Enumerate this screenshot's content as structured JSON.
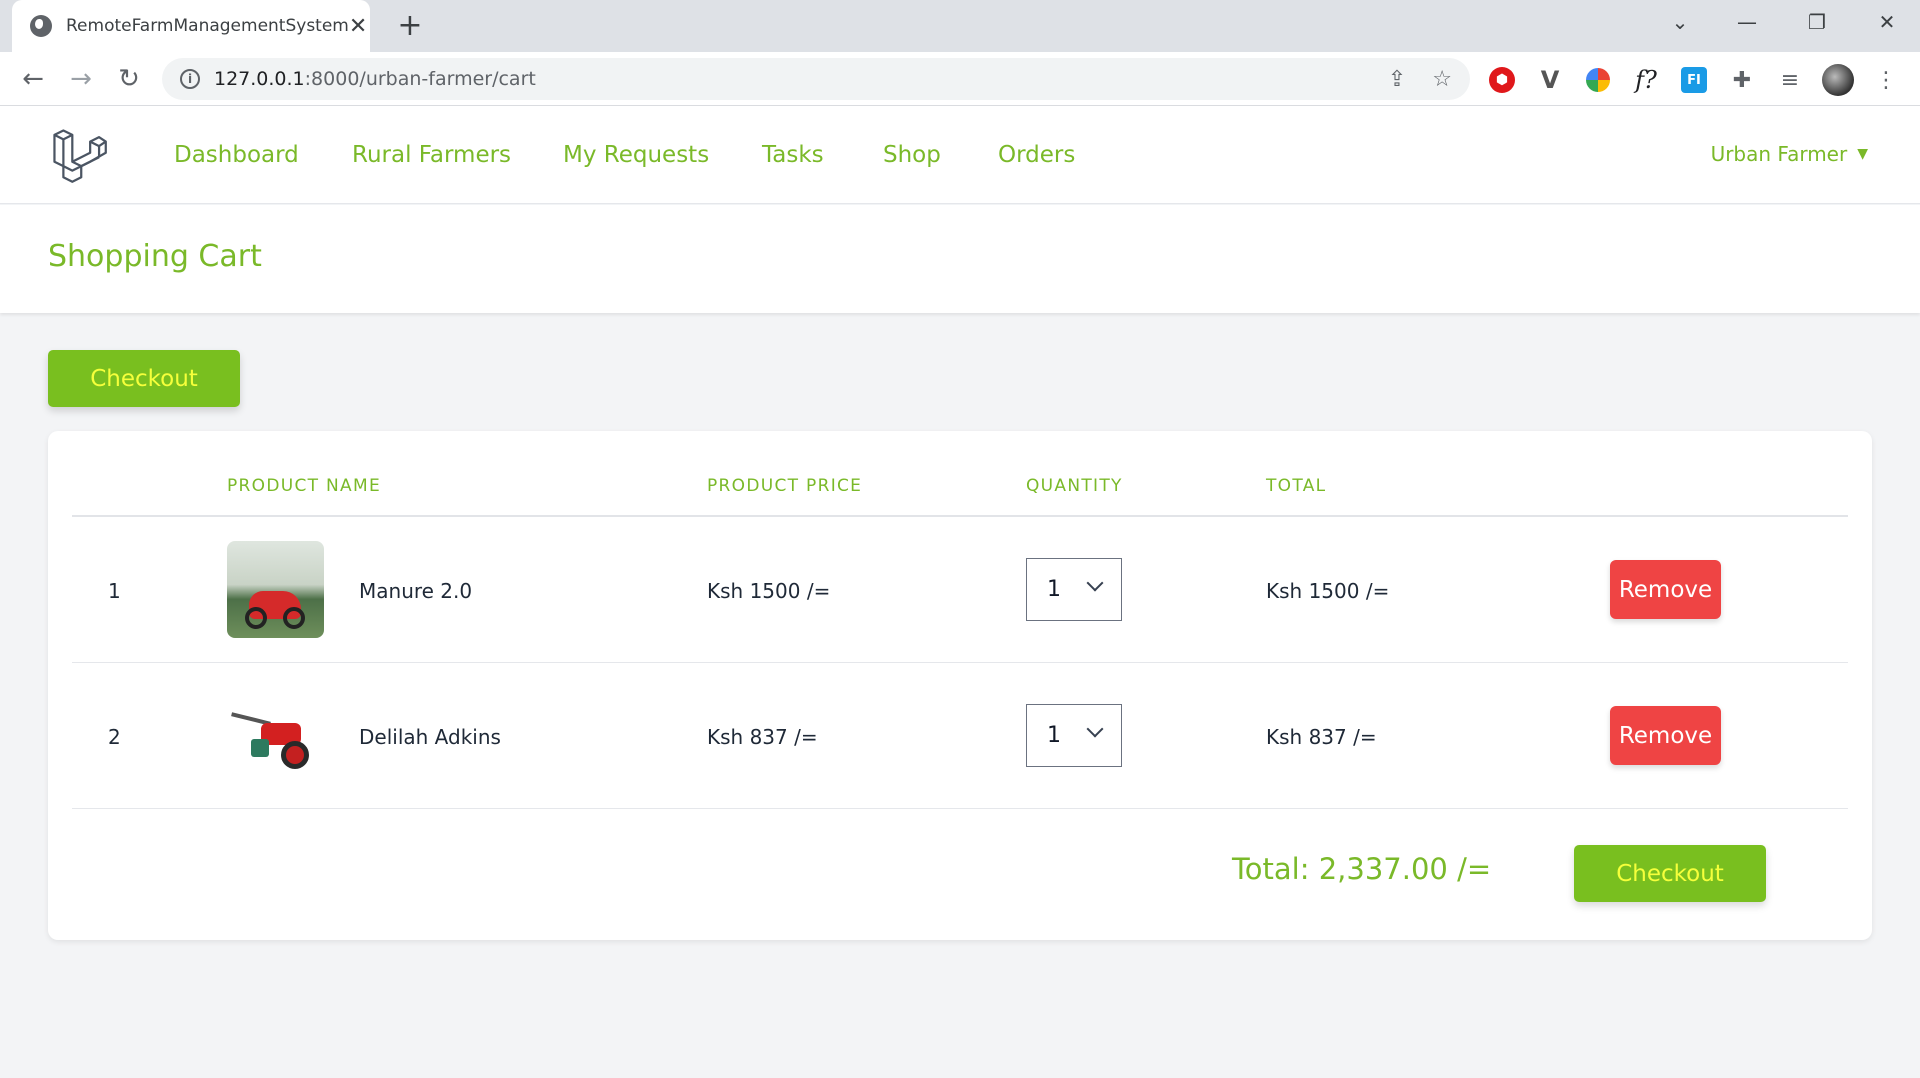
{
  "browser": {
    "tab_title": "RemoteFarmManagementSystem",
    "tab_close": "✕",
    "new_tab": "+",
    "url_host": "127.0.0.1",
    "url_rest": ":8000/urban-farmer/cart",
    "window_controls": [
      "minimize-icon",
      "restore-icon",
      "close-icon"
    ],
    "extensions": [
      "shield-ext-icon",
      "v-ext-icon",
      "color-wheel-ext-icon",
      "font-ext-icon",
      "fi-ext-icon",
      "puzzle-icon",
      "media-list-icon",
      "profile-avatar"
    ]
  },
  "nav": {
    "links": [
      "Dashboard",
      "Rural Farmers",
      "My Requests",
      "Tasks",
      "Shop",
      "Orders"
    ],
    "user": "Urban Farmer"
  },
  "page": {
    "title": "Shopping Cart",
    "checkout_label": "Checkout"
  },
  "table": {
    "headers": [
      "PRODUCT NAME",
      "PRODUCT PRICE",
      "QUANTITY",
      "TOTAL"
    ],
    "rows": [
      {
        "index": "1",
        "name": "Manure 2.0",
        "price": "Ksh 1500 /=",
        "quantity": "1",
        "total": "Ksh 1500 /=",
        "remove": "Remove",
        "image": "motorbike-photo"
      },
      {
        "index": "2",
        "name": "Delilah Adkins",
        "price": "Ksh 837 /=",
        "quantity": "1",
        "total": "Ksh 837 /=",
        "remove": "Remove",
        "image": "walking-tractor-photo"
      }
    ],
    "grand_total": "Total: 2,337.00 /=",
    "checkout_label": "Checkout"
  },
  "colors": {
    "accent_green": "#7ab929",
    "button_green": "#79bf1f",
    "button_text": "#f5ff3b",
    "remove_red": "#ef4444"
  }
}
